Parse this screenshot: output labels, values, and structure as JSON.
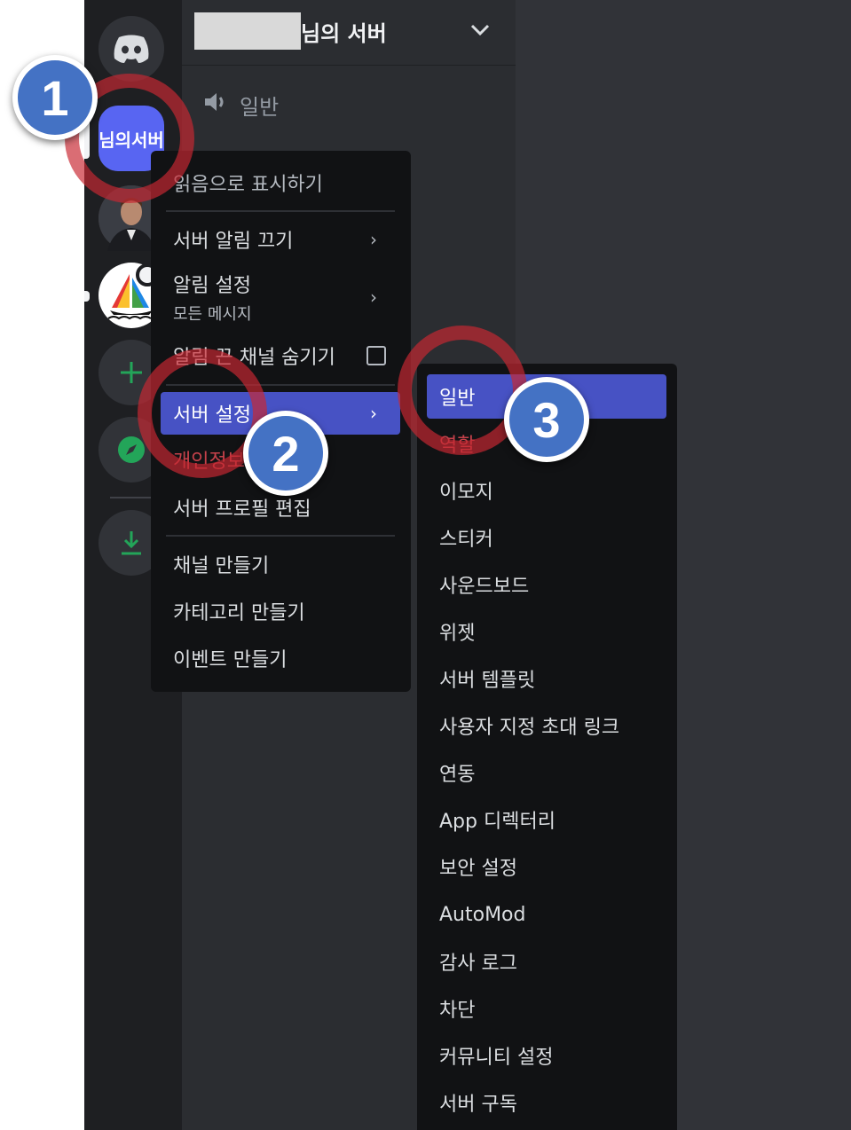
{
  "header": {
    "server_name": "님의 서버"
  },
  "channels": [
    {
      "name": "일반"
    }
  ],
  "guild_rail": {
    "active_label": "님의서버"
  },
  "context_menu": {
    "mark_read": "읽음으로 표시하기",
    "mute_server": "서버 알림 끄기",
    "notify_settings": "알림 설정",
    "notify_settings_sub": "모든 메시지",
    "hide_muted": "알림 끈 채널 숨기기",
    "server_settings": "서버 설정",
    "privacy": "개인정보 보호 설정",
    "edit_profile": "서버 프로필 편집",
    "create_channel": "채널 만들기",
    "create_category": "카테고리 만들기",
    "create_event": "이벤트 만들기"
  },
  "settings_submenu": {
    "items": [
      "일반",
      "역할",
      "이모지",
      "스티커",
      "사운드보드",
      "위젯",
      "서버 템플릿",
      "사용자 지정 초대 링크",
      "연동",
      "App 디렉터리",
      "보안 설정",
      "AutoMod",
      "감사 로그",
      "차단",
      "커뮤니티 설정",
      "서버 구독"
    ]
  },
  "annotations": {
    "step1": "1",
    "step2": "2",
    "step3": "3"
  },
  "colors": {
    "accent": "#5865f2",
    "menu_active": "#4752c4",
    "badge": "#4472c4",
    "ring": "#c82832"
  }
}
